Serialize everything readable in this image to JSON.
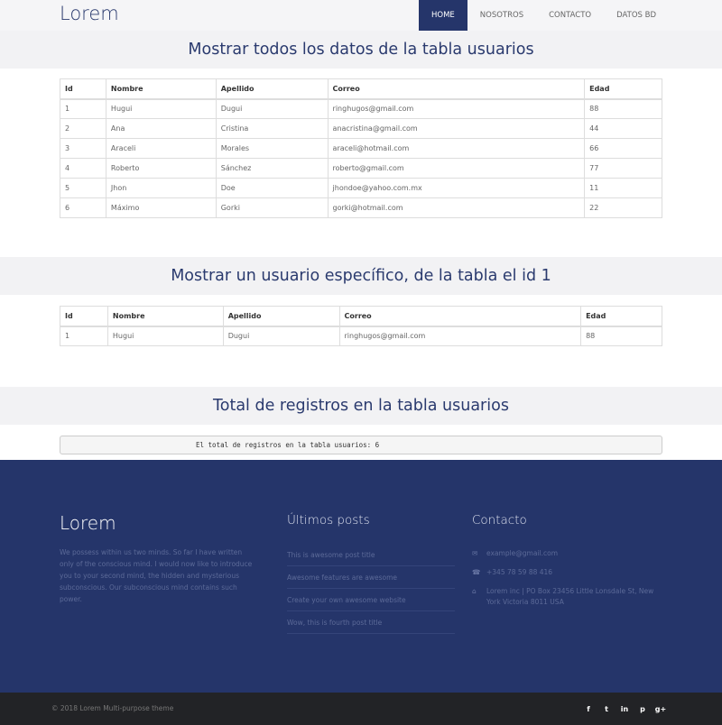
{
  "navbar": {
    "brand": "Lorem",
    "items": [
      "HOME",
      "NOSOTROS",
      "CONTACTO",
      "DATOS BD"
    ]
  },
  "section1": {
    "title": "Mostrar todos los datos de la tabla usuarios",
    "headers": [
      "Id",
      "Nombre",
      "Apellido",
      "Correo",
      "Edad"
    ],
    "rows": [
      [
        "1",
        "Hugui",
        "Dugui",
        "ringhugos@gmail.com",
        "88"
      ],
      [
        "2",
        "Ana",
        "Cristina",
        "anacristina@gmail.com",
        "44"
      ],
      [
        "3",
        "Araceli",
        "Morales",
        "araceli@hotmail.com",
        "66"
      ],
      [
        "4",
        "Roberto",
        "Sánchez",
        "roberto@gmail.com",
        "77"
      ],
      [
        "5",
        "Jhon",
        "Doe",
        "jhondoe@yahoo.com.mx",
        "11"
      ],
      [
        "6",
        "Máximo",
        "Gorki",
        "gorki@hotmail.com",
        "22"
      ]
    ]
  },
  "section2": {
    "title": "Mostrar un usuario específico, de la tabla el id 1",
    "headers": [
      "Id",
      "Nombre",
      "Apellido",
      "Correo",
      "Edad"
    ],
    "rows": [
      [
        "1",
        "Hugui",
        "Dugui",
        "ringhugos@gmail.com",
        "88"
      ]
    ]
  },
  "section3": {
    "title": "Total de registros en la tabla usuarios",
    "total_text": "El total de registros en la tabla usuarios: 6"
  },
  "footer": {
    "logo": "Lorem",
    "about": "We possess within us two minds. So far I have written only of the conscious mind. I would now like to introduce you to your second mind, the hidden and mysterious subconscious. Our subconscious mind contains such power.",
    "posts_title": "Últimos posts",
    "posts": [
      "This is awesome post title",
      "Awesome features are awesome",
      "Create your own awesome website",
      "Wow, this is fourth post title"
    ],
    "contact_title": "Contacto",
    "email": "example@gmail.com",
    "phone": "+345 78 59 88 416",
    "address": "Lorem inc | PO Box 23456 Little Lonsdale St, New York Victoria 8011 USA"
  },
  "bottombar": {
    "copyright": "© 2018 Lorem Multi-purpose theme",
    "social": [
      "f",
      "t",
      "in",
      "p",
      "g+"
    ]
  },
  "icons": {
    "email": "envelope-icon",
    "phone": "phone-icon",
    "address": "home-icon"
  },
  "colors": {
    "primary": "#25356a",
    "header_bg": "#f2f2f4",
    "bottom_bar": "#222326"
  }
}
